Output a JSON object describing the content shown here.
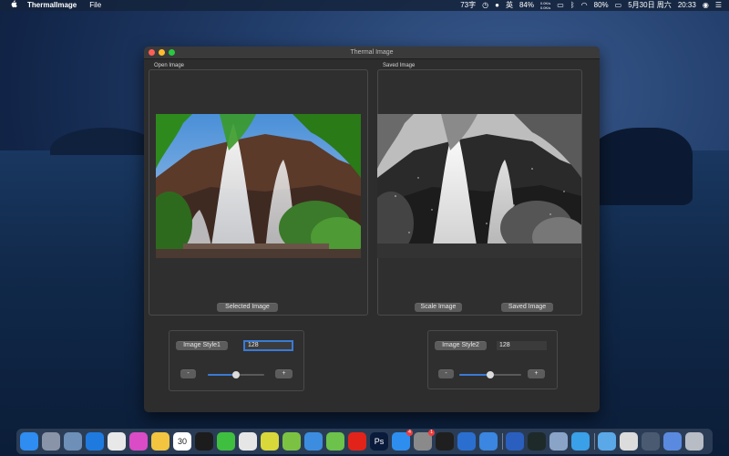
{
  "menubar": {
    "app_name": "ThermalImage",
    "menu_file": "File",
    "status": {
      "input_count": "73字",
      "input_method": "英",
      "battery_level": "84%",
      "network_up": "0.0K/s",
      "network_down": "0.0K/s",
      "volume": "80%",
      "date": "5月30日 周六",
      "time": "20:33"
    }
  },
  "window": {
    "title": "Thermal Image",
    "open_panel": {
      "label": "Open Image",
      "button": "Selected Image"
    },
    "saved_panel": {
      "label": "Saved Image",
      "scale_button": "Scale Image",
      "save_button": "Saved Image"
    },
    "style1": {
      "button": "Image Style1",
      "value": "128",
      "minus": "-",
      "plus": "+",
      "slider_level": 0.5
    },
    "style2": {
      "button": "Image Style2",
      "value": "128",
      "minus": "-",
      "plus": "+",
      "slider_level": 0.5
    }
  },
  "dock": {
    "items": [
      {
        "icon": "finder-icon",
        "color": "#2f8cf0"
      },
      {
        "icon": "launchpad-icon",
        "color": "#8a94a8"
      },
      {
        "icon": "preview-icon",
        "color": "#6d8fb8"
      },
      {
        "icon": "safari-icon",
        "color": "#1f7ae0"
      },
      {
        "icon": "chrome-icon",
        "color": "#e8e8e8"
      },
      {
        "icon": "color-wheel-icon",
        "color": "#d94cc5"
      },
      {
        "icon": "photos-icon",
        "color": "#f2c440"
      },
      {
        "icon": "calendar-icon",
        "color": "#ffffff",
        "text": "30"
      },
      {
        "icon": "qq-icon",
        "color": "#1c1c1c"
      },
      {
        "icon": "wechat-icon",
        "color": "#3fbf3f"
      },
      {
        "icon": "messages-icon",
        "color": "#e6e6e6"
      },
      {
        "icon": "pencil-icon",
        "color": "#d8d83a"
      },
      {
        "icon": "android-icon",
        "color": "#7cc242"
      },
      {
        "icon": "xcode-icon",
        "color": "#3c8de0"
      },
      {
        "icon": "notes-icon",
        "color": "#6cc24a"
      },
      {
        "icon": "youdao-icon",
        "color": "#e2231a"
      },
      {
        "icon": "photoshop-icon",
        "color": "#0a1a3a",
        "text": "Ps"
      },
      {
        "icon": "app-store-icon",
        "color": "#2d8ef0",
        "badge": "4"
      },
      {
        "icon": "system-preferences-icon",
        "color": "#8a8a8a",
        "badge": "1"
      },
      {
        "icon": "terminal-icon",
        "color": "#1f1f1f"
      },
      {
        "icon": "thermal-app-icon",
        "color": "#2a6fd0"
      },
      {
        "icon": "settings-gear-icon",
        "color": "#3a86e0"
      },
      {
        "icon": "vpn-icon",
        "color": "#2a5fbf"
      },
      {
        "icon": "activity-monitor-icon",
        "color": "#1e2a2a"
      },
      {
        "icon": "image-viewer-icon",
        "color": "#8aa4c8"
      },
      {
        "icon": "thermal-image-icon",
        "color": "#3aa0e8"
      },
      {
        "icon": "folder-icon",
        "color": "#5aa8e8"
      },
      {
        "icon": "document-icon",
        "color": "#dcdcdc"
      },
      {
        "icon": "screenshots-icon",
        "color": "#4a5a70"
      },
      {
        "icon": "downloads-icon",
        "color": "#5a8ae0"
      },
      {
        "icon": "trash-icon",
        "color": "#b8bcc4"
      }
    ]
  }
}
